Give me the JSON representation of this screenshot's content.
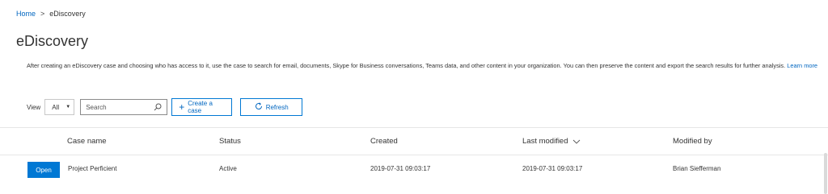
{
  "breadcrumb": {
    "home": "Home",
    "separator": ">",
    "current": "eDiscovery"
  },
  "page": {
    "title": "eDiscovery",
    "description": "After creating an eDiscovery case and choosing who has access to it, use the case to search for email, documents, Skype for Business conversations, Teams data, and other content in your organization. You can then preserve the content and export the search results for further analysis.",
    "learn_more": "Learn more"
  },
  "toolbar": {
    "view_label": "View",
    "view_selected": "All",
    "search_placeholder": "Search",
    "create_label": "Create a case",
    "refresh_label": "Refresh"
  },
  "table": {
    "headers": {
      "case_name": "Case name",
      "status": "Status",
      "created": "Created",
      "last_modified": "Last modified",
      "modified_by": "Modified by"
    },
    "rows": [
      {
        "open_label": "Open",
        "case_name": "Project Perficient",
        "status": "Active",
        "created": "2019-07-31 09:03:17",
        "last_modified": "2019-07-31 09:03:17",
        "modified_by": "Brian Siefferman"
      }
    ]
  },
  "colors": {
    "accent": "#0078d4",
    "link": "#0066c0",
    "text": "#333333"
  },
  "icons": {
    "search": "search-icon",
    "add": "plus-icon",
    "refresh": "refresh-icon",
    "sort": "chevron-down-icon",
    "dropdown": "caret-down-icon"
  }
}
